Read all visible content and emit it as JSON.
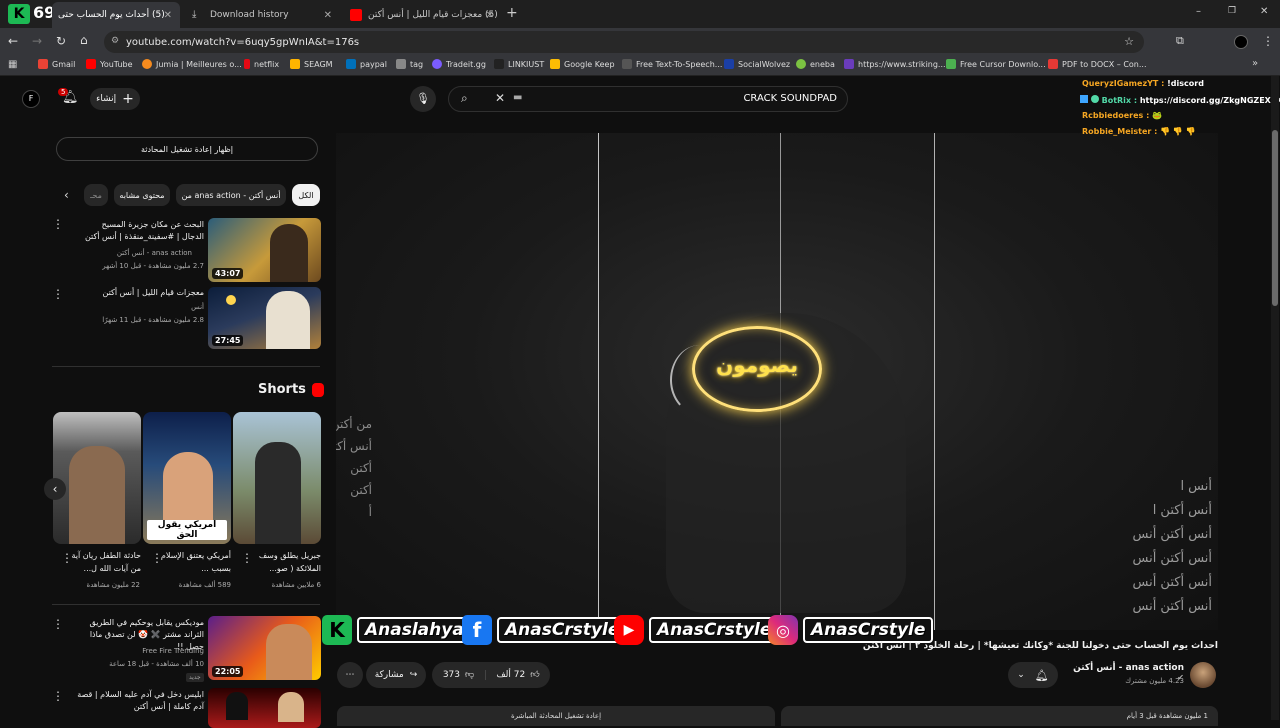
{
  "browser": {
    "tabs": [
      {
        "title": "(5) أحداث يوم الحساب حتى",
        "badge": "69"
      },
      {
        "title": "Download history"
      },
      {
        "title": "(5) معجزات قيام الليل | أنس أكتن"
      }
    ],
    "new_tab": "+",
    "url": "youtube.com/watch?v=6uqy5gpWnIA&t=176s",
    "bookmarks": [
      "Gmail",
      "YouTube",
      "Jumia | Meilleures o...",
      "netflix",
      "SEAGM",
      "paypal",
      "tag",
      "Tradeit.gg",
      "LINKIUST",
      "Google Keep",
      "Free Text-To-Speech...",
      "SocialWolvez",
      "eneba",
      "https://www.striking...",
      "Free Cursor Downlo...",
      "PDF to DOCX – Con..."
    ],
    "window_controls": {
      "minimize": "–",
      "restore": "❐",
      "close": "✕"
    }
  },
  "header": {
    "avatar_letter": "F",
    "notification_count": "5",
    "create_label": "إنشاء",
    "search_query": "CRACK SOUNDPAD"
  },
  "sidebar": {
    "show_chat_replay": "إظهار إعادة تشغيل المحادثة",
    "chips": [
      "الكل",
      "من anas action - أنس أكتن",
      "محتوى مشابه",
      "محـ"
    ],
    "videos": [
      {
        "title": "البحث عن مكان جزيرة المسيح الدجال | #سفينة_منقذة | أنس أكتن",
        "channel": "anas action - أنس أكتن",
        "meta": "2.7 مليون مشاهدة - قبل 10 أشهر",
        "duration": "43:07"
      },
      {
        "title": "معجزات قيام الليل | أنس أكتن",
        "channel": "أنس",
        "meta": "2.8 مليون مشاهدة - قبل 11 شهرًا",
        "duration": "27:45"
      }
    ],
    "shorts_label": "Shorts",
    "shorts": [
      {
        "title": "جبريل يطلق وسف الملائكة ( صو...",
        "views": "6 ملايين مشاهدة",
        "overlay": ""
      },
      {
        "title": "أمريكي يعتنق الإسلام بسبب ...",
        "views": "589 ألف مشاهدة",
        "overlay": "امريكي يقول الحق"
      },
      {
        "title": "حادثة الطفل ريان آية من آيات الله ل...",
        "views": "22 مليون مشاهدة",
        "overlay": ""
      }
    ],
    "more_videos": [
      {
        "title": "موديكس يقابل يوحكيم في الطريق الثراند مشتر ✖️ 🤡 لن تصدق ماذا حصل !!",
        "channel": "Free Fire Trending",
        "meta": "10 ألف مشاهدة - قبل 18 ساعة",
        "duration": "22:05",
        "badge": "جديد"
      },
      {
        "title": "ابليس دخل في آدم عليه السلام | قصة آدم كاملة | أنس أكتن",
        "channel": "",
        "meta": "",
        "duration": ""
      }
    ]
  },
  "player": {
    "center_text": "يصومون",
    "left_faint": "من أكتن\nأنس أكتن\nأكتن\nأكتن\nأ",
    "right_faint": [
      "أنس ا",
      "أنس أكتن ا",
      "أنس أكتن أنس",
      "أنس أكتن أنس",
      "أنس أكتن أنس",
      "أنس أكتن أنس"
    ]
  },
  "chat_overlay": [
    {
      "user": "QueryzIGamezYT :",
      "message": "!discord",
      "color": "#f5a623"
    },
    {
      "user": "BotRix :",
      "message": "https://discord.gg/ZkgNGZEXaK",
      "color": "#52d9a8"
    },
    {
      "user": "Rcbbiedoeres :",
      "message": "🐸",
      "color": "#f5a623"
    },
    {
      "user": "Robbie_Meister :",
      "message": "👎 👎 👎",
      "color": "#f5a623"
    }
  ],
  "socials": {
    "k_handle": "Anaslahya",
    "facebook": "AnasCrstyle",
    "youtube": "AnasCrstyle",
    "instagram": "AnasCrstyle"
  },
  "video_info": {
    "title": "أحداث يوم الحساب حتى دخولنا للجنة *وكأنك تعيشها* | رحلة الخلود ٢ | أنس أكتن",
    "channel": "anas action - أنس أكتن",
    "subscribers": "4.23 مليون مشترك",
    "likes": "72 ألف",
    "dislikes": "373",
    "share": "مشاركة",
    "description_start": "1 مليون مشاهدة قبل 3 أيام",
    "chat_replay": "إعادة تشغيل المحادثة المباشرة"
  },
  "colors": {
    "accent_red": "#ff0000",
    "chat_gold": "#f5a623"
  }
}
